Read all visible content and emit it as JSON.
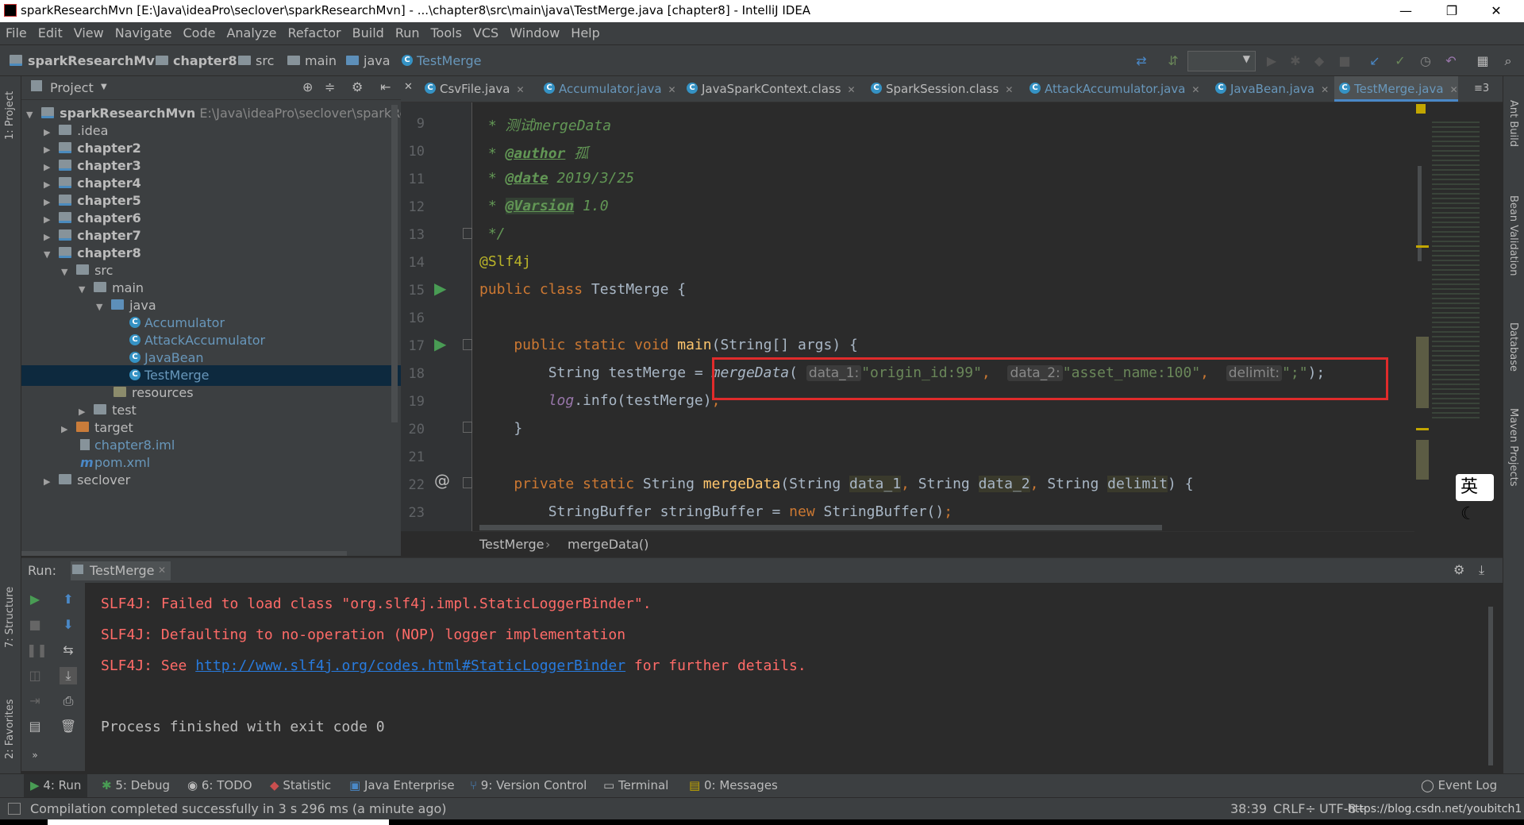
{
  "window": {
    "title": "sparkResearchMvn [E:\\Java\\ideaPro\\seclover\\sparkResearchMvn] - ...\\chapter8\\src\\main\\java\\TestMerge.java [chapter8] - IntelliJ IDEA",
    "minimize": "—",
    "restore": "❐",
    "close": "✕"
  },
  "menu": [
    "File",
    "Edit",
    "View",
    "Navigate",
    "Code",
    "Analyze",
    "Refactor",
    "Build",
    "Run",
    "Tools",
    "VCS",
    "Window",
    "Help"
  ],
  "nav": {
    "crumbs": [
      "sparkResearchMvn",
      "chapter8",
      "src",
      "main",
      "java",
      "TestMerge"
    ]
  },
  "left_strip": {
    "project": "1: Project",
    "structure": "7: Structure",
    "favorites": "2: Favorites"
  },
  "right_strip": {
    "ant": "Ant Build",
    "bean": "Bean Validation",
    "database": "Database",
    "maven": "Maven Projects"
  },
  "project": {
    "header": "Project",
    "root": {
      "name": "sparkResearchMvn",
      "path": "E:\\Java\\ideaPro\\seclover\\sparkResearc"
    },
    "items": [
      {
        "label": ".idea"
      },
      {
        "label": "chapter2"
      },
      {
        "label": "chapter3"
      },
      {
        "label": "chapter4"
      },
      {
        "label": "chapter5"
      },
      {
        "label": "chapter6"
      },
      {
        "label": "chapter7"
      },
      {
        "label": "chapter8"
      },
      {
        "label": "src"
      },
      {
        "label": "main"
      },
      {
        "label": "java"
      },
      {
        "label": "Accumulator"
      },
      {
        "label": "AttackAccumulator"
      },
      {
        "label": "JavaBean"
      },
      {
        "label": "TestMerge"
      },
      {
        "label": "resources"
      },
      {
        "label": "test"
      },
      {
        "label": "target"
      },
      {
        "label": "chapter8.iml"
      },
      {
        "label": "pom.xml"
      },
      {
        "label": "seclover"
      }
    ]
  },
  "tabs": [
    {
      "label": "CsvFile.java"
    },
    {
      "label": "Accumulator.java"
    },
    {
      "label": "JavaSparkContext.class"
    },
    {
      "label": "SparkSession.class"
    },
    {
      "label": "AttackAccumulator.java"
    },
    {
      "label": "JavaBean.java"
    },
    {
      "label": "TestMerge.java"
    }
  ],
  "tabs_overflow": "≡3",
  "code": {
    "line_numbers": [
      "9",
      "10",
      "11",
      "12",
      "13",
      "14",
      "15",
      "16",
      "17",
      "18",
      "19",
      "20",
      "21",
      "22",
      "23"
    ],
    "l9": " * 测试mergeData",
    "l10_tag": "@author",
    "l10_val": " 孤",
    "l11_tag": "@date",
    "l11_val": " 2019/3/25",
    "l12_tag": "@Varsion",
    "l12_val": " 1.0",
    "l13": " */",
    "l14": "@Slf4j",
    "l15_kw": "public class ",
    "l15_rest": "TestMerge {",
    "l17_kw": "    public static void ",
    "l17_fn": "main",
    "l17_rest": "(String[] args) {",
    "l18_pre": "        String testMerge = ",
    "l18_call": "mergeData",
    "l18_h1": "data_1:",
    "l18_s1": "\"origin_id:99\"",
    "l18_h2": "data_2:",
    "l18_s2": "\"asset_name:100\"",
    "l18_h3": "delimit:",
    "l18_s3": "\";\"",
    "l18_end": ");",
    "l19_log": "log",
    "l19_rest": ".info(testMerge)",
    "l19_semi": ";",
    "l20": "    }",
    "l22_kw": "    private static ",
    "l22_t": "String ",
    "l22_fn": "mergeData",
    "l22_p1": "data_1",
    "l22_p2": "data_2",
    "l22_p3": "delimit",
    "l23_pre": "        StringBuffer stringBuffer = ",
    "l23_kw": "new ",
    "l23_rest": "StringBuffer()",
    "l23_semi": ";"
  },
  "editor_breadcrumb": [
    "TestMerge",
    "mergeData()"
  ],
  "ime": {
    "lang": "英",
    "moon": "☾"
  },
  "run": {
    "label": "Run:",
    "tab": "TestMerge",
    "console": {
      "line1": "SLF4J: Failed to load class \"org.slf4j.impl.StaticLoggerBinder\".",
      "line2": "SLF4J: Defaulting to no-operation (NOP) logger implementation",
      "line3_pre": "SLF4J: See ",
      "line3_link": "http://www.slf4j.org/codes.html#StaticLoggerBinder",
      "line3_post": " for further details.",
      "line4": "Process finished with exit code 0"
    }
  },
  "toolwindows": [
    {
      "label": "4: Run"
    },
    {
      "label": "5: Debug"
    },
    {
      "label": "6: TODO"
    },
    {
      "label": "Statistic"
    },
    {
      "label": "Java Enterprise"
    },
    {
      "label": "9: Version Control"
    },
    {
      "label": "Terminal"
    },
    {
      "label": "0: Messages"
    }
  ],
  "event_log": "Event Log",
  "status": {
    "message": "Compilation completed successfully in 3 s 296 ms (a minute ago)",
    "position": "38:39",
    "line_sep": "CRLF÷",
    "encoding": "UTF-8÷",
    "watermark": "https://blog.csdn.net/youbitch1"
  },
  "colors": {
    "bg": "#2b2b2b",
    "panel": "#3c3f41",
    "keyword": "#cc7832",
    "string": "#6a8759",
    "comment": "#629755",
    "function": "#ffc66d",
    "error": "#ff6b68",
    "link": "#287bde",
    "highlight_box": "#e02b2b"
  }
}
